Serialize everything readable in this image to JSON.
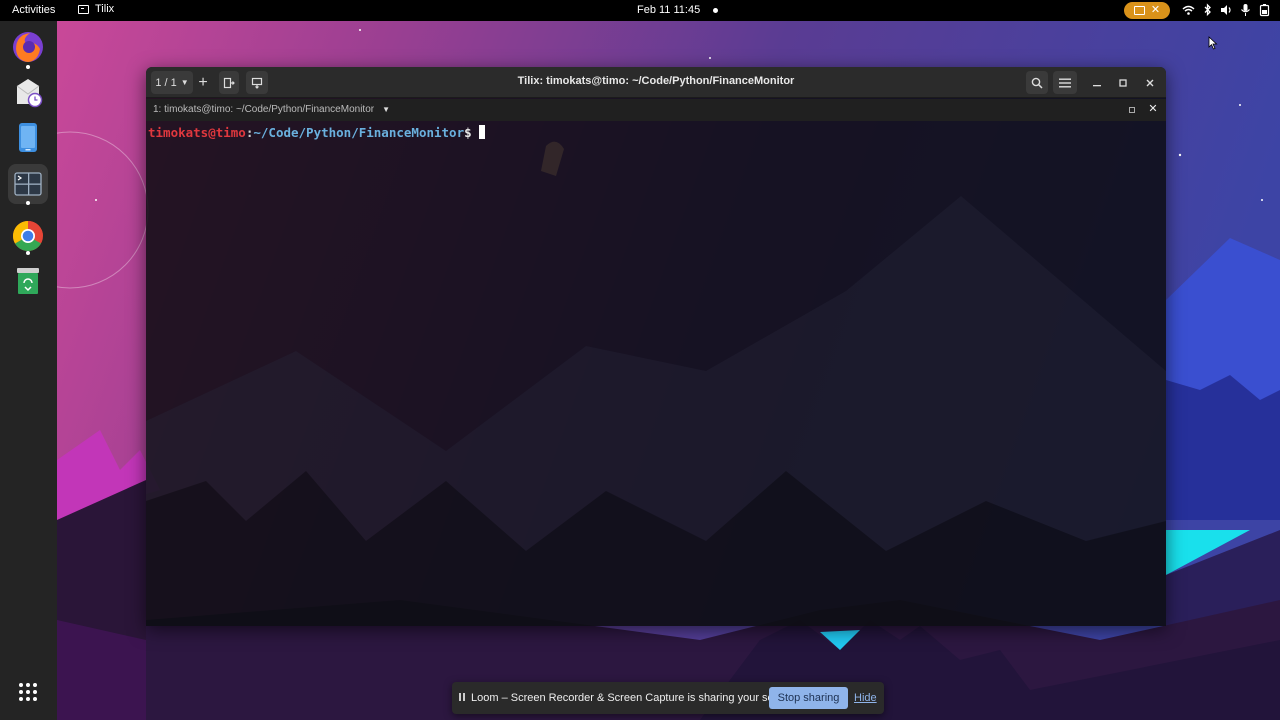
{
  "topbar": {
    "activities_label": "Activities",
    "app_name": "Tilix",
    "clock": "Feb 11  11:45",
    "tray_icons": [
      "screen-share-icon",
      "close-icon",
      "wifi-icon",
      "bluetooth-icon",
      "volume-icon",
      "microphone-icon",
      "battery-icon"
    ]
  },
  "dock": {
    "apps": [
      {
        "name": "firefox",
        "icon": "firefox-icon",
        "running": true
      },
      {
        "name": "evolution",
        "icon": "mail-clock-icon",
        "running": false
      },
      {
        "name": "phone-link",
        "icon": "phone-icon",
        "running": false
      },
      {
        "name": "tilix",
        "icon": "terminal-icon",
        "running": true,
        "active": true
      },
      {
        "name": "chrome",
        "icon": "chrome-icon",
        "running": true
      },
      {
        "name": "trash",
        "icon": "trash-icon",
        "running": false
      }
    ],
    "show_apps_icon": "app-grid-icon"
  },
  "window": {
    "session_switcher": "1 / 1",
    "title": "Tilix: timokats@timo: ~/Code/Python/FinanceMonitor",
    "terminal_title": "1: timokats@timo: ~/Code/Python/FinanceMonitor",
    "prompt": {
      "user_host": "timokats@timo",
      "sep": ":",
      "path": "~/Code/Python/FinanceMonitor",
      "symbol": "$"
    }
  },
  "share_notice": {
    "message": "Loom – Screen Recorder & Screen Capture is sharing your screen.",
    "stop_label": "Stop sharing",
    "hide_label": "Hide"
  },
  "colors": {
    "prompt_user": "#e0383e",
    "prompt_path": "#6ab0de",
    "recording_pill": "#d9921a",
    "accent_button": "#8fb4ea"
  }
}
